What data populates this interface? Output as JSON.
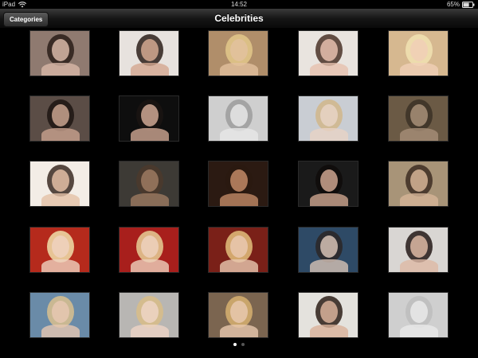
{
  "status_bar": {
    "device": "iPad",
    "time": "14:52",
    "battery": "65%"
  },
  "nav": {
    "title": "Celebrities",
    "back_label": "Categories"
  },
  "grid": {
    "rows": 5,
    "columns": 5,
    "thumbnails": [
      {
        "bg": "#8f7a70",
        "face": "#d8b8a8",
        "hair": "#2a1d18"
      },
      {
        "bg": "#e7e2de",
        "face": "#d4a890",
        "hair": "#2b1e1a"
      },
      {
        "bg": "#b08e6a",
        "face": "#e2c19e",
        "hair": "#e3c889"
      },
      {
        "bg": "#e9e4df",
        "face": "#e6c0ae",
        "hair": "#4a3328"
      },
      {
        "bg": "#d6b890",
        "face": "#f0cfb6",
        "hair": "#f1e2b3"
      },
      {
        "bg": "#5b4d46",
        "face": "#c9a38f",
        "hair": "#1d1512"
      },
      {
        "bg": "#0e0e0e",
        "face": "#cfa894",
        "hair": "#1a1412"
      },
      {
        "bg": "#cfcfcf",
        "face": "#e7e7e7",
        "hair": "#9c9c9c"
      },
      {
        "bg": "#c9cdd3",
        "face": "#e8d3c5",
        "hair": "#d1b689"
      },
      {
        "bg": "#6b5a45",
        "face": "#a78f78",
        "hair": "#3b3126"
      },
      {
        "bg": "#f3ede6",
        "face": "#e3c0a6",
        "hair": "#3a2a22"
      },
      {
        "bg": "#3d3a35",
        "face": "#9c7a62",
        "hair": "#4b3a2c"
      },
      {
        "bg": "#2b1a12",
        "face": "#c28a66",
        "hair": "#2a1a10"
      },
      {
        "bg": "#1a1a1a",
        "face": "#cda58f",
        "hair": "#0f0c0b"
      },
      {
        "bg": "#a89478",
        "face": "#d6b497",
        "hair": "#3d2d22"
      },
      {
        "bg": "#b52a1c",
        "face": "#efd2bf",
        "hair": "#f0dfaa"
      },
      {
        "bg": "#a81f1c",
        "face": "#edd1bd",
        "hair": "#e6cf96"
      },
      {
        "bg": "#7a2018",
        "face": "#e9c8b0",
        "hair": "#e3c07c"
      },
      {
        "bg": "#2e4a66",
        "face": "#d6c2b5",
        "hair": "#2a2626"
      },
      {
        "bg": "#d9d6d3",
        "face": "#ddb9a5",
        "hair": "#231916"
      },
      {
        "bg": "#6a8ba8",
        "face": "#e6c7b1",
        "hair": "#d9c08e"
      },
      {
        "bg": "#b8b6b3",
        "face": "#edd5c6",
        "hair": "#d8bd87"
      },
      {
        "bg": "#7b6550",
        "face": "#e8c8ae",
        "hair": "#d7b070"
      },
      {
        "bg": "#e4e2dd",
        "face": "#d9b29a",
        "hair": "#2d1e17"
      },
      {
        "bg": "#cfcfcf",
        "face": "#e9e9e9",
        "hair": "#bdbdbd"
      }
    ]
  },
  "page_control": {
    "pages": 2,
    "current": 1
  }
}
